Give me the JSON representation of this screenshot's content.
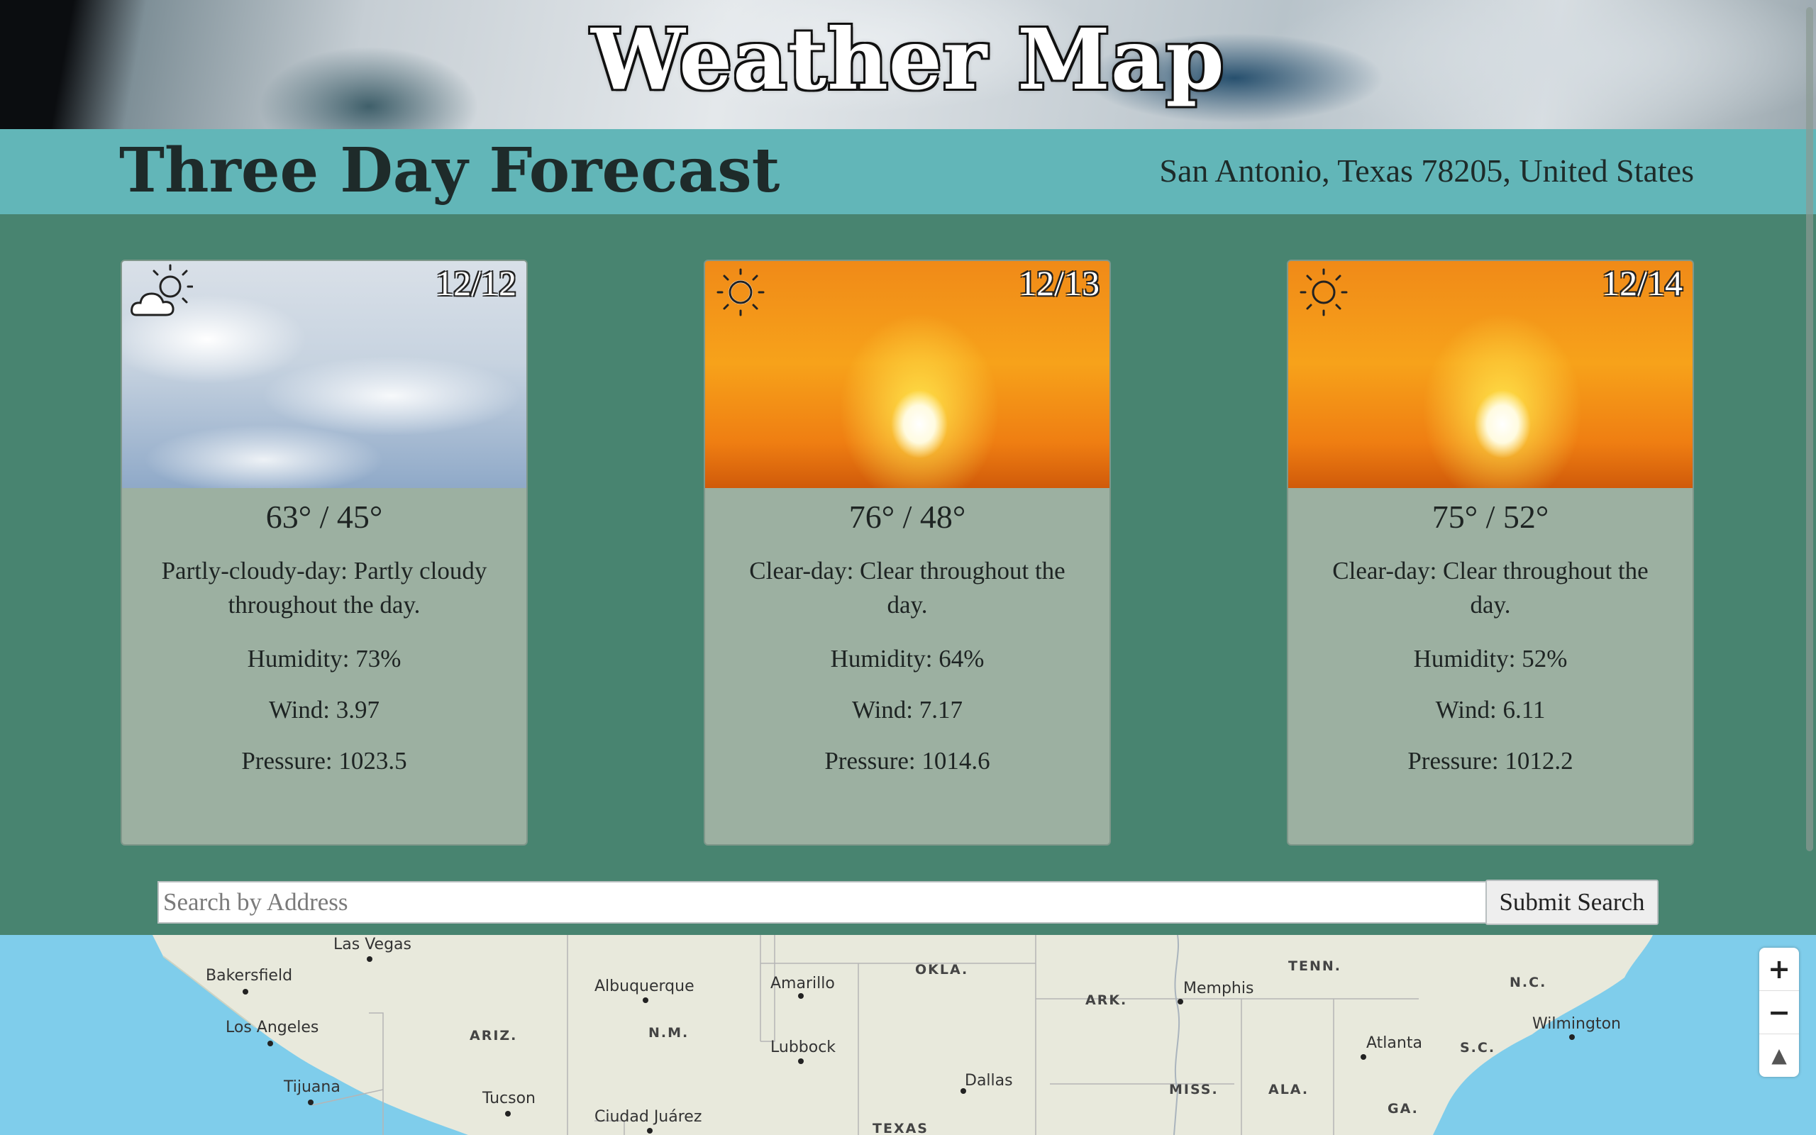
{
  "app": {
    "title": "Weather Map"
  },
  "header": {
    "heading": "Three Day Forecast",
    "location": "San Antonio, Texas 78205, United States"
  },
  "days": [
    {
      "date": "12/12",
      "icon": "partly-cloudy-day-icon",
      "temp": "63° / 45°",
      "summary_label": "Partly-cloudy-day:",
      "summary_text": "Partly cloudy throughout the day.",
      "humidity_label": "Humidity:",
      "humidity": "73%",
      "wind_label": "Wind:",
      "wind": "3.97",
      "pressure_label": "Pressure:",
      "pressure": "1023.5"
    },
    {
      "date": "12/13",
      "icon": "clear-day-icon",
      "temp": "76° / 48°",
      "summary_label": "Clear-day:",
      "summary_text": "Clear throughout the day.",
      "humidity_label": "Humidity:",
      "humidity": "64%",
      "wind_label": "Wind:",
      "wind": "7.17",
      "pressure_label": "Pressure:",
      "pressure": "1014.6"
    },
    {
      "date": "12/14",
      "icon": "clear-day-icon",
      "temp": "75° / 52°",
      "summary_label": "Clear-day:",
      "summary_text": "Clear throughout the day.",
      "humidity_label": "Humidity:",
      "humidity": "52%",
      "wind_label": "Wind:",
      "wind": "6.11",
      "pressure_label": "Pressure:",
      "pressure": "1012.2"
    }
  ],
  "search": {
    "placeholder": "Search by Address",
    "value": "",
    "button_label": "Submit Search"
  },
  "map": {
    "cities": [
      "Las Vegas",
      "Bakersfield",
      "Los Angeles",
      "Tijuana",
      "Tucson",
      "Albuquerque",
      "Amarillo",
      "Lubbock",
      "Ciudad Juárez",
      "Dallas",
      "Memphis",
      "Atlanta",
      "Wilmington"
    ],
    "states": [
      "OKLA.",
      "TENN.",
      "N.C.",
      "ARK.",
      "ARIZ.",
      "N.M.",
      "S.C.",
      "MISS.",
      "ALA.",
      "GA.",
      "TEXAS"
    ],
    "zoom_in": "+",
    "zoom_out": "−",
    "compass": "▲"
  }
}
